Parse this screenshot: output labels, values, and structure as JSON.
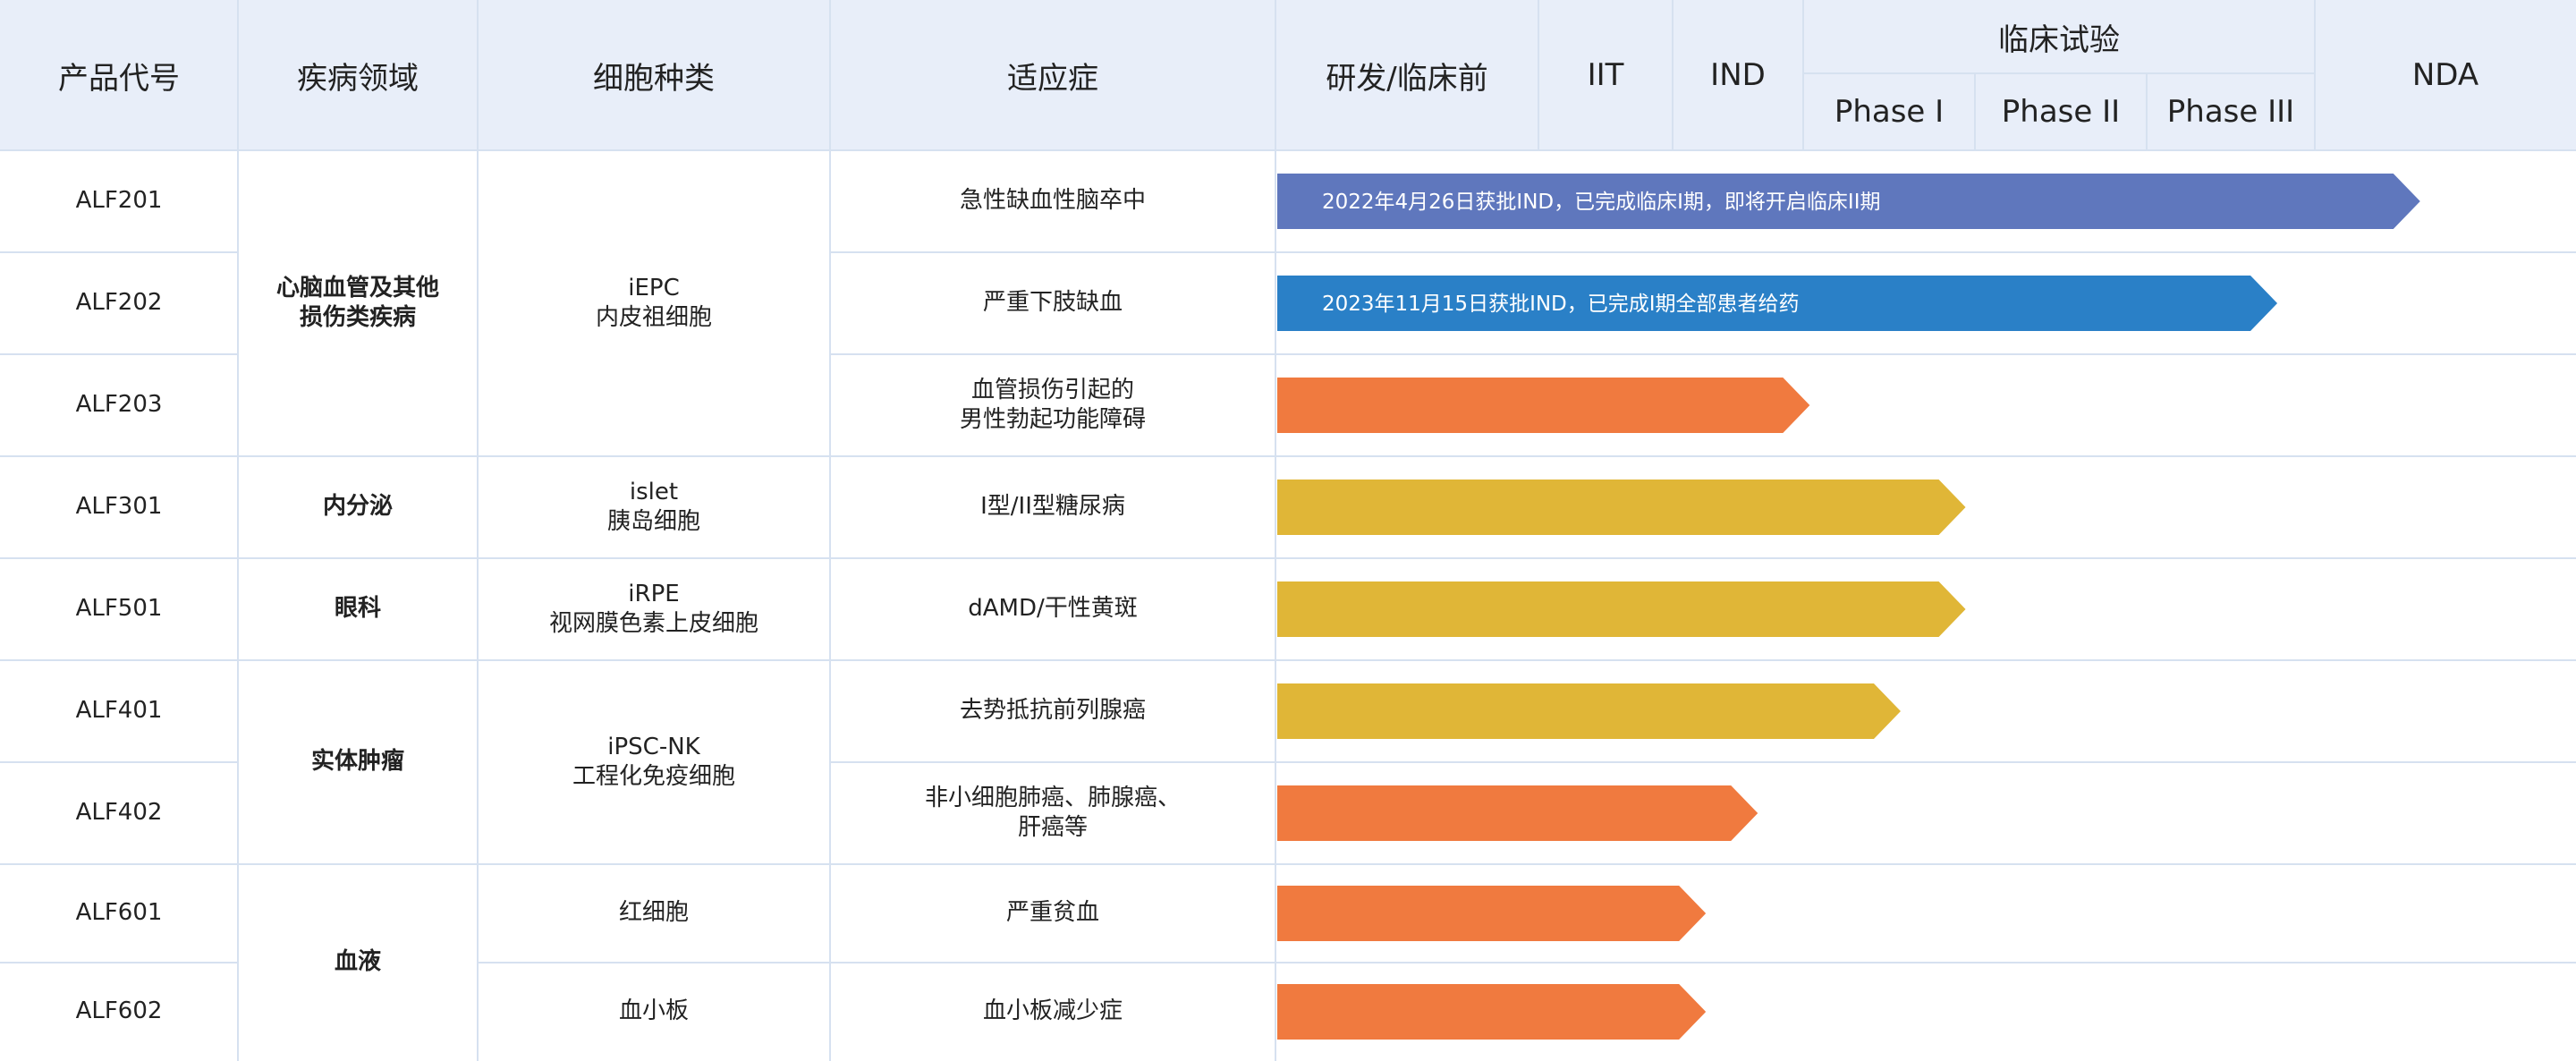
{
  "header": {
    "product_code": "产品代号",
    "disease_area": "疾病领域",
    "cell_type": "细胞种类",
    "indication": "适应症",
    "preclinical": "研发/临床前",
    "iit": "IIT",
    "ind": "IND",
    "clinical": "临床试验",
    "phase1": "Phase I",
    "phase2": "Phase II",
    "phase3": "Phase III",
    "nda": "NDA"
  },
  "groups": {
    "area_cardio": "心脑血管及其他\n损伤类疾病",
    "area_endocrine": "内分泌",
    "area_eye": "眼科",
    "area_tumor": "实体肿瘤",
    "area_blood": "血液",
    "cell_iepc": "iEPC\n内皮祖细胞",
    "cell_islet": "islet\n胰岛细胞",
    "cell_irpe": "iRPE\n视网膜色素上皮细胞",
    "cell_ipscnk": "iPSC-NK\n工程化免疫细胞",
    "cell_rbc": "红细胞",
    "cell_platelet": "血小板"
  },
  "rows": [
    {
      "code": "ALF201",
      "indication": "急性缺血性脑卒中"
    },
    {
      "code": "ALF202",
      "indication": "严重下肢缺血"
    },
    {
      "code": "ALF203",
      "indication": "血管损伤引起的\n男性勃起功能障碍"
    },
    {
      "code": "ALF301",
      "indication": "I型/II型糖尿病"
    },
    {
      "code": "ALF501",
      "indication": "dAMD/干性黄斑"
    },
    {
      "code": "ALF401",
      "indication": "去势抵抗前列腺癌"
    },
    {
      "code": "ALF402",
      "indication": "非小细胞肺癌、肺腺癌、\n肝癌等"
    },
    {
      "code": "ALF601",
      "indication": "严重贫血"
    },
    {
      "code": "ALF602",
      "indication": "血小板减少症"
    }
  ],
  "chart_data": {
    "type": "bar",
    "orientation": "horizontal",
    "stages": [
      "研发/临床前",
      "IIT",
      "IND",
      "Phase I",
      "Phase II",
      "Phase III",
      "NDA"
    ],
    "categories": [
      "ALF201",
      "ALF202",
      "ALF203",
      "ALF301",
      "ALF501",
      "ALF401",
      "ALF402",
      "ALF601",
      "ALF602"
    ],
    "progress_fraction": [
      0.88,
      0.77,
      0.41,
      0.53,
      0.53,
      0.48,
      0.37,
      0.33,
      0.33
    ],
    "colors": [
      "#5f77bd",
      "#2a80c7",
      "#f07a3f",
      "#e0b637",
      "#e0b637",
      "#e0b637",
      "#f07a3f",
      "#f07a3f",
      "#f07a3f"
    ],
    "labels": [
      "2022年4月26日获批IND，已完成临床I期，即将开启临床II期",
      "2023年11月15日获批IND，已完成I期全部患者给药",
      "",
      "",
      "",
      "",
      "",
      "",
      ""
    ]
  }
}
